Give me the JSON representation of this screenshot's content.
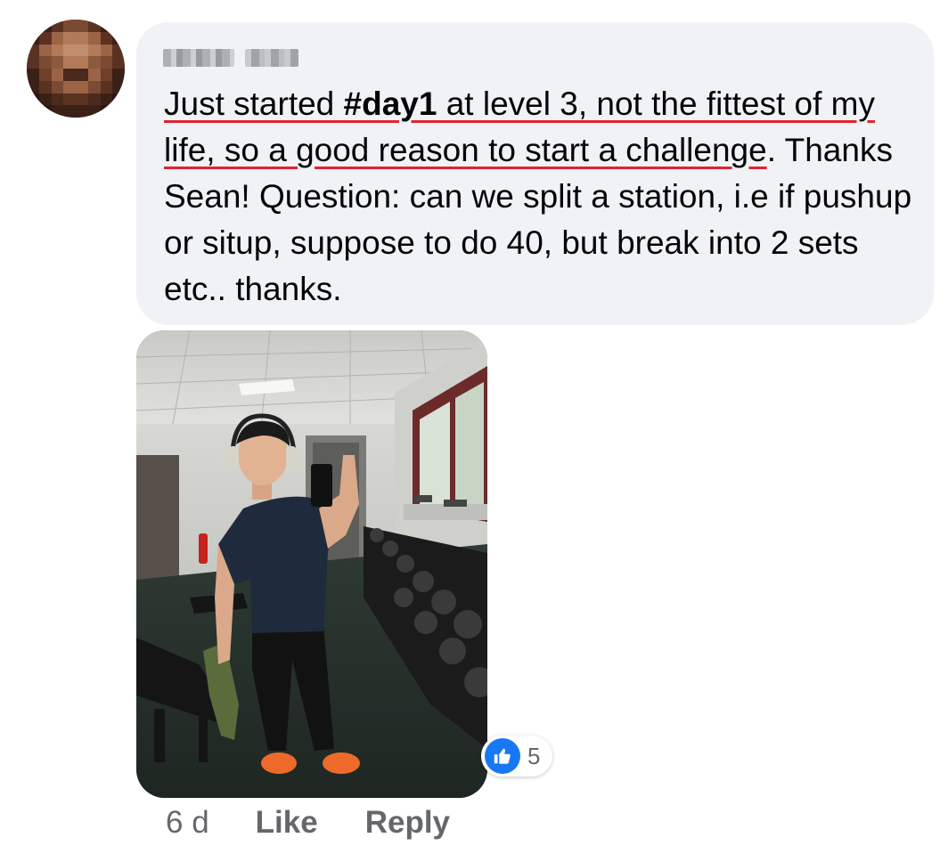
{
  "comment": {
    "text_parts": {
      "p1": "Just started ",
      "hashtag": "#day1",
      "p2": " at level 3, not the fittest of my life, so a good reason to start a challenge",
      "p3": ". Thanks Sean! Question:  can we split a station, i.e if pushup or situp, suppose to do 40, but break into 2 sets etc.. thanks."
    }
  },
  "reactions": {
    "icon": "thumbs-up-icon",
    "color": "#1877f2",
    "count": "5"
  },
  "actions": {
    "timestamp": "6 d",
    "like_label": "Like",
    "reply_label": "Reply"
  },
  "colors": {
    "bubble": "#f0f2f5",
    "text": "#050505",
    "muted": "#65676b",
    "spellcheck": "#e0242f"
  }
}
